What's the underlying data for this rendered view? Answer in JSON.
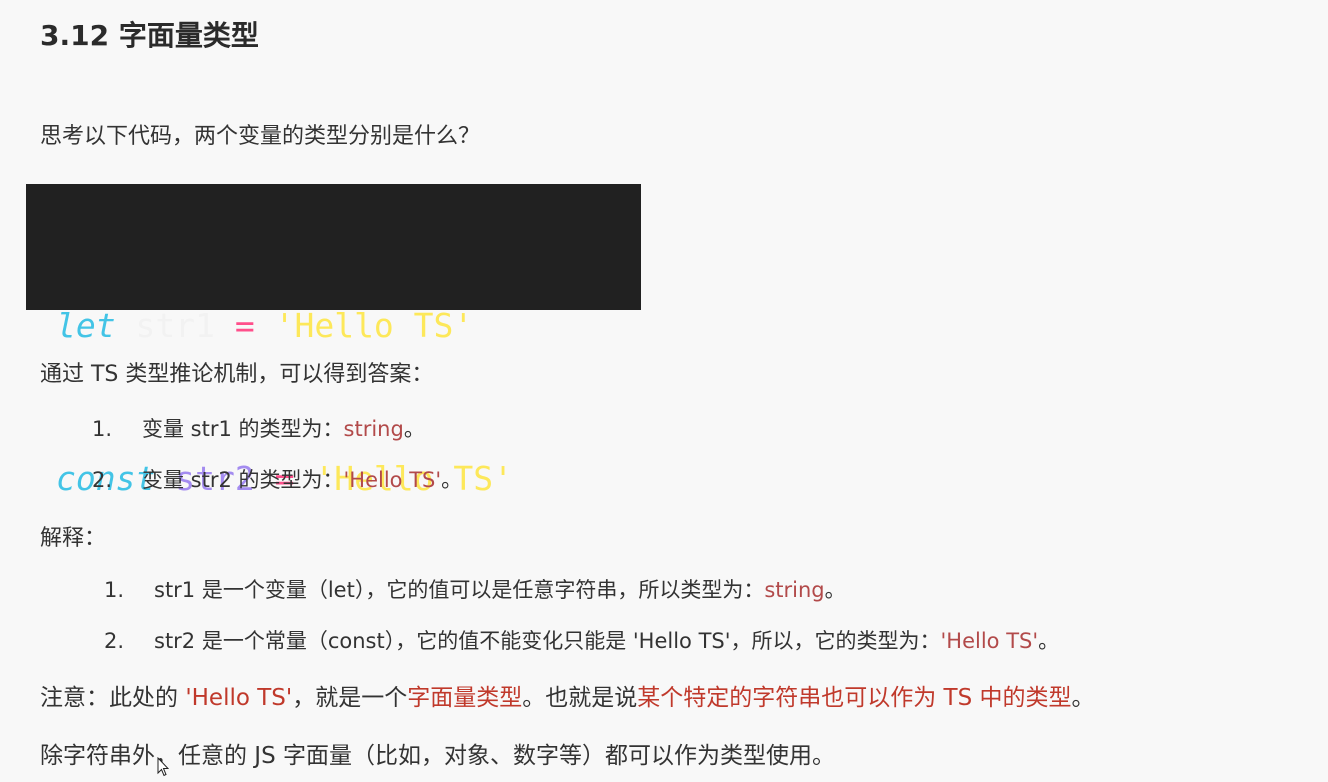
{
  "title": "3.12 字面量类型",
  "intro": "思考以下代码，两个变量的类型分别是什么？",
  "code": {
    "line1": {
      "keyword": "let",
      "variable": "str1",
      "operator": "=",
      "value": "'Hello TS'"
    },
    "line2": {
      "keyword": "const",
      "variable": "str2",
      "operator": "=",
      "value": "'Hello TS'"
    }
  },
  "answer_intro": "通过 TS 类型推论机制，可以得到答案：",
  "answers": [
    {
      "num": "1.",
      "text": "变量 str1 的类型为：",
      "type": "string",
      "end": "。"
    },
    {
      "num": "2.",
      "text": "变量 str2 的类型为：",
      "type": "'Hello TS'",
      "end": "。"
    }
  ],
  "explain_label": "解释：",
  "explanations": [
    {
      "num": "1.",
      "text": "str1 是一个变量（let），它的值可以是任意字符串，所以类型为：",
      "type": "string",
      "end": "。"
    },
    {
      "num": "2.",
      "text": "str2 是一个常量（const），它的值不能变化只能是 'Hello TS'，所以，它的类型为：",
      "type": "'Hello TS'",
      "end": "。"
    }
  ],
  "note": {
    "prefix": "注意：此处的 ",
    "value": "'Hello TS'",
    "middle": "，就是一个",
    "term": "字面量类型",
    "middle2": "。也就是说",
    "emphasis": "某个特定的字符串也可以作为 TS 中的类型",
    "end": "。"
  },
  "final": "除字符串外，任意的 JS 字面量（比如，对象、数字等）都可以作为类型使用。",
  "colors": {
    "keyword": "#43c4e6",
    "const_variable": "#a48cf0",
    "operator": "#ff4f8b",
    "string": "#fde85a",
    "highlight": "#b24a4a",
    "code_bg": "#212121"
  }
}
